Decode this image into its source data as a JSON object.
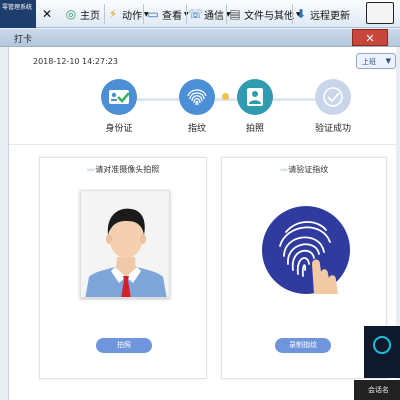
{
  "toolbar": {
    "app_tab": "零管理系统",
    "home": "主页",
    "action": "动作",
    "view": "查看",
    "communication": "通信",
    "files": "文件与其他",
    "remote_update": "远程更新"
  },
  "window": {
    "title": "打卡"
  },
  "header": {
    "datetime": "2018-12-10 14:27:23",
    "status_select": "上班"
  },
  "steps": [
    {
      "label": "身份证",
      "state": "done"
    },
    {
      "label": "指纹",
      "state": "done"
    },
    {
      "label": "拍照",
      "state": "current"
    },
    {
      "label": "验证成功",
      "state": "pending"
    }
  ],
  "cards": {
    "camera": {
      "title": "请对准摄像头拍照",
      "button": "拍照"
    },
    "fingerprint": {
      "title": "请验证指纹",
      "button": "录制指纹"
    }
  },
  "taskbar": {
    "label": "会话名"
  },
  "colors": {
    "accent": "#6f95dd",
    "step_done": "#4d8fd6",
    "step_pending": "#c9d6ea",
    "fingerprint_bg": "#2f3b9e",
    "close": "#c9463d"
  }
}
